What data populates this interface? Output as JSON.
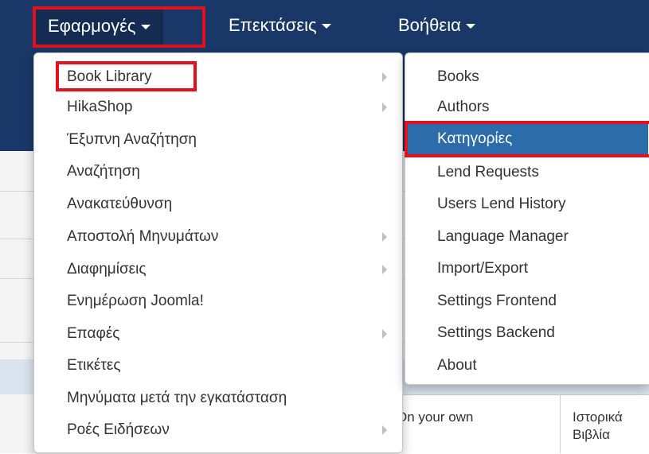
{
  "navbar": {
    "apps_label": "Εφαρμογές",
    "extensions_label": "Επεκτάσεις",
    "help_label": "Βοήθεια"
  },
  "main_menu": {
    "items": [
      {
        "label": "Book Library",
        "has_submenu": true
      },
      {
        "label": "HikaShop",
        "has_submenu": true
      },
      {
        "label": "Έξυπνη Αναζήτηση",
        "has_submenu": false
      },
      {
        "label": "Αναζήτηση",
        "has_submenu": false
      },
      {
        "label": "Ανακατεύθυνση",
        "has_submenu": false
      },
      {
        "label": "Αποστολή Μηνυμάτων",
        "has_submenu": true
      },
      {
        "label": "Διαφημίσεις",
        "has_submenu": true
      },
      {
        "label": "Ενημέρωση Joomla!",
        "has_submenu": false
      },
      {
        "label": "Επαφές",
        "has_submenu": true
      },
      {
        "label": "Ετικέτες",
        "has_submenu": false
      },
      {
        "label": "Μηνύματα μετά την εγκατάσταση",
        "has_submenu": false
      },
      {
        "label": "Ροές Ειδήσεων",
        "has_submenu": true
      }
    ]
  },
  "sub_menu": {
    "items": [
      {
        "label": "Books"
      },
      {
        "label": "Authors"
      },
      {
        "label": "Κατηγορίες",
        "active": true
      },
      {
        "label": "Lend Requests"
      },
      {
        "label": "Users Lend History"
      },
      {
        "label": "Language Manager"
      },
      {
        "label": "Import/Export"
      },
      {
        "label": "Settings Frontend"
      },
      {
        "label": "Settings Backend"
      },
      {
        "label": "About"
      }
    ]
  },
  "background_table": {
    "cell_1": "On your own",
    "cell_2_line1": "Ιστορικά",
    "cell_2_line2": "Βιβλία"
  },
  "colors": {
    "navbar": "#1a3867",
    "highlight": "#e3101d",
    "active_item": "#2d6cab"
  }
}
